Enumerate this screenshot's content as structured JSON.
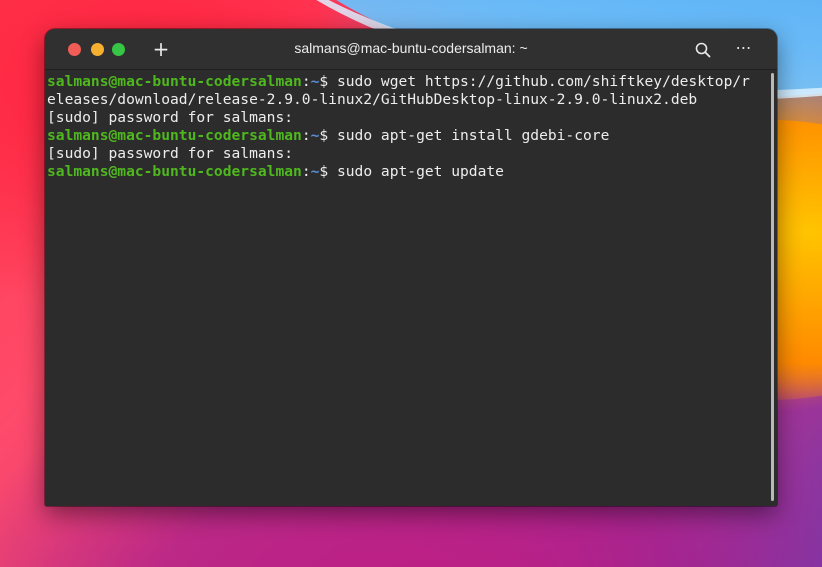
{
  "window": {
    "title": "salmans@mac-buntu-codersalman: ~",
    "new_tab_glyph": "+",
    "menu_glyph": "⋯"
  },
  "icons": {
    "close": "close-dot-icon",
    "minimize": "minimize-dot-icon",
    "maximize": "maximize-dot-icon",
    "new_tab": "plus-icon",
    "search": "search-icon",
    "menu": "more-options-icon"
  },
  "colors": {
    "close": "#f05c56",
    "minimize": "#f6b030",
    "maximize": "#36c545",
    "prompt_user": "#4fb81e",
    "prompt_path": "#5a8fd8",
    "terminal_bg": "#2c2c2c",
    "terminal_text": "#ededed"
  },
  "terminal": {
    "prompt": {
      "user_host": "salmans@mac-buntu-codersalman",
      "separator": ":",
      "path": "~",
      "symbol": "$"
    },
    "lines": [
      {
        "type": "command",
        "text": " sudo wget https://github.com/shiftkey/desktop/r"
      },
      {
        "type": "output",
        "text": "eleases/download/release-2.9.0-linux2/GitHubDesktop-linux-2.9.0-linux2.deb"
      },
      {
        "type": "output",
        "text": "[sudo] password for salmans:"
      },
      {
        "type": "command",
        "text": " sudo apt-get install gdebi-core"
      },
      {
        "type": "output",
        "text": "[sudo] password for salmans:"
      },
      {
        "type": "command",
        "text": " sudo apt-get update"
      }
    ]
  }
}
